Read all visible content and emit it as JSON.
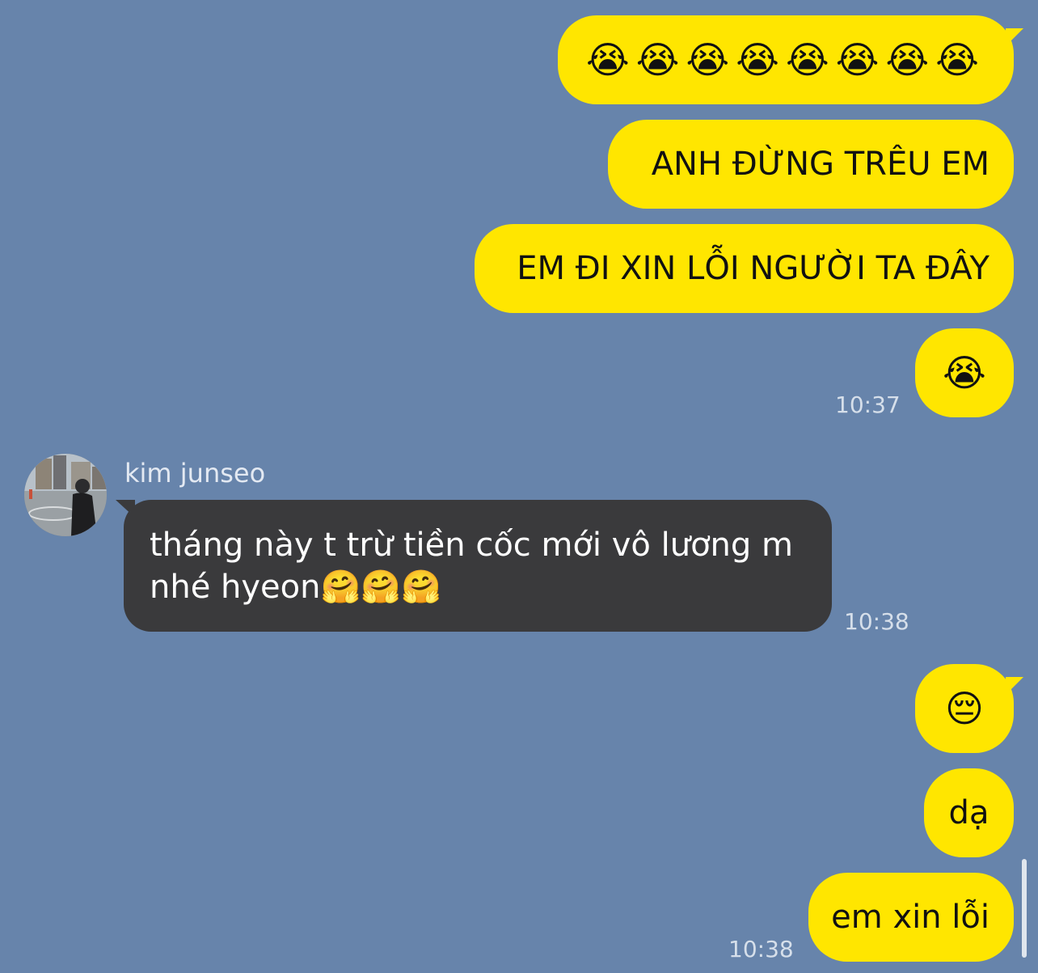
{
  "conversation": {
    "messages": [
      {
        "sender": "me",
        "text": "😭😭😭😭😭😭😭😭"
      },
      {
        "sender": "me",
        "text": "ANH ĐỪNG TRÊU EM"
      },
      {
        "sender": "me",
        "text": "EM ĐI XIN LỖI NGƯỜI TA ĐÂY"
      },
      {
        "sender": "me",
        "text": "😭",
        "time": "10:37"
      },
      {
        "sender": "them",
        "name": "kim junseo",
        "lines": [
          "tháng này t trừ tiền cốc mới vô lương m",
          "nhé hyeon🤗🤗🤗"
        ],
        "time": "10:38"
      },
      {
        "sender": "me",
        "text": "😔"
      },
      {
        "sender": "me",
        "text": "dạ"
      },
      {
        "sender": "me",
        "text": "em xin lỗi",
        "time": "10:38"
      }
    ]
  },
  "colors": {
    "background": "#6784ab",
    "my_bubble": "#ffe600",
    "their_bubble": "#3a3a3c"
  }
}
